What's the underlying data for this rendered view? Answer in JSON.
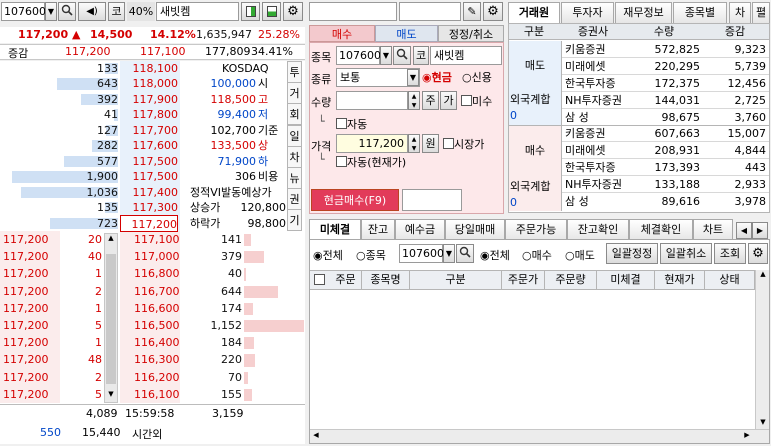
{
  "left": {
    "toolbar": {
      "code": "107600",
      "badge": "코",
      "margin": "40%",
      "name": "새빗켐"
    },
    "price_line": {
      "price": "117,200",
      "arrow": "▲",
      "change": "14,500",
      "rate": "14.12%",
      "volume": "1,635,947",
      "turnover": "25.28%"
    },
    "header": {
      "label": "증감",
      "bid_price": "117,200",
      "ask_price": "117,100",
      "volume": "177,809",
      "volume_rate": "34.41%"
    },
    "ask_rows": [
      {
        "qty": "133",
        "price": "118,100",
        "info_label": "KOSDAQ",
        "info_value": "",
        "bar": 0.12
      },
      {
        "qty": "643",
        "price": "118,000",
        "info_label": "시",
        "info_value": "100,000",
        "bar": 0.55
      },
      {
        "qty": "392",
        "price": "117,900",
        "info_label": "고",
        "info_value": "118,500",
        "bar": 0.34
      },
      {
        "qty": "41",
        "price": "117,800",
        "info_label": "저",
        "info_value": "99,400",
        "bar": 0.04
      },
      {
        "qty": "127",
        "price": "117,700",
        "info_label": "기준",
        "info_value": "102,700",
        "bar": 0.11
      },
      {
        "qty": "282",
        "price": "117,600",
        "info_label": "상",
        "info_value": "133,500",
        "bar": 0.24
      },
      {
        "qty": "577",
        "price": "117,500",
        "info_label": "하",
        "info_value": "71,900",
        "bar": 0.49
      },
      {
        "qty": "1,900",
        "price": "117,500",
        "info_label": "비용",
        "info_value": "306",
        "bar": 0.96
      },
      {
        "qty": "1,036",
        "price": "117,400",
        "info_label": "정적VI발동예상가",
        "info_value": "",
        "bar": 0.88
      },
      {
        "qty": "135",
        "price": "117,300",
        "info_label": "상승가",
        "info_value": "120,800",
        "bar": 0.12
      },
      {
        "qty": "723",
        "price": "117,200",
        "info_label": "하락가",
        "info_value": "98,800",
        "bar": 0.62
      }
    ],
    "side_buttons": [
      "투",
      "거",
      "회",
      "일",
      "차",
      "뉴",
      "권",
      "기"
    ],
    "bid_rows": [
      {
        "cmp": "117,200",
        "chg": "20",
        "price": "117,100",
        "qty": "141",
        "bar": 0.12
      },
      {
        "cmp": "117,200",
        "chg": "40",
        "price": "117,000",
        "qty": "379",
        "bar": 0.33
      },
      {
        "cmp": "117,200",
        "chg": "1",
        "price": "116,800",
        "qty": "40",
        "bar": 0.04
      },
      {
        "cmp": "117,200",
        "chg": "2",
        "price": "116,700",
        "qty": "644",
        "bar": 0.56
      },
      {
        "cmp": "117,200",
        "chg": "1",
        "price": "116,600",
        "qty": "174",
        "bar": 0.15
      },
      {
        "cmp": "117,200",
        "chg": "5",
        "price": "116,500",
        "qty": "1,152",
        "bar": 1.0
      },
      {
        "cmp": "117,200",
        "chg": "1",
        "price": "116,400",
        "qty": "184",
        "bar": 0.16
      },
      {
        "cmp": "117,200",
        "chg": "48",
        "price": "116,300",
        "qty": "220",
        "bar": 0.19
      },
      {
        "cmp": "117,200",
        "chg": "2",
        "price": "116,200",
        "qty": "70",
        "bar": 0.06
      },
      {
        "cmp": "117,200",
        "chg": "5",
        "price": "116,100",
        "qty": "155",
        "bar": 0.13
      }
    ],
    "footer": {
      "ask_total": "4,089",
      "time": "15:59:58",
      "bid_total": "3,159",
      "after_left": "550",
      "after_qty": "15,440",
      "after_label": "시간외"
    }
  },
  "order": {
    "tabs": [
      "매수",
      "매도",
      "정정/취소"
    ],
    "code_label": "종목",
    "code": "107600",
    "badge": "코",
    "name": "새빗켐",
    "type_label": "종류",
    "type_value": "보통",
    "radio_cash": "현금",
    "radio_credit": "신용",
    "qty_label": "수량",
    "qty_btn1": "주",
    "qty_btn2": "가",
    "undecided": "미수",
    "auto1": "자동",
    "price_label": "가격",
    "price_value": "117,200",
    "price_unit": "원",
    "market_price": "시장가",
    "auto2": "자동(현재가)",
    "submit": "현금매수(F9)"
  },
  "broker": {
    "tabs": [
      "거래원",
      "투자자",
      "재무정보",
      "종목별",
      "차",
      "펼"
    ],
    "headers": [
      "구분",
      "증권사",
      "수량",
      "증감"
    ],
    "sell_label": "매도",
    "buy_label": "매수",
    "foreign_label": "외국계합",
    "foreign_sell_val": "0",
    "foreign_buy_val": "0",
    "sell": [
      {
        "firm": "키움증권",
        "qty": "572,825",
        "chg": "9,323"
      },
      {
        "firm": "미래에셋",
        "qty": "220,295",
        "chg": "5,739"
      },
      {
        "firm": "한국투자증",
        "qty": "172,375",
        "chg": "12,456"
      },
      {
        "firm": "NH투자증권",
        "qty": "144,031",
        "chg": "2,725"
      },
      {
        "firm": "삼 성",
        "qty": "98,675",
        "chg": "3,760"
      }
    ],
    "buy": [
      {
        "firm": "키움증권",
        "qty": "607,663",
        "chg": "15,007"
      },
      {
        "firm": "미래에셋",
        "qty": "208,931",
        "chg": "4,844"
      },
      {
        "firm": "한국투자증",
        "qty": "173,393",
        "chg": "443"
      },
      {
        "firm": "NH투자증권",
        "qty": "133,188",
        "chg": "2,933"
      },
      {
        "firm": "삼 성",
        "qty": "89,616",
        "chg": "3,978"
      }
    ]
  },
  "bottom": {
    "tabs": [
      "미체결",
      "잔고",
      "예수금",
      "당일매매",
      "주문가능",
      "잔고확인",
      "체결확인",
      "차트"
    ],
    "filter1": {
      "all": "전체",
      "stock": "종목",
      "code": "107600"
    },
    "filter2": {
      "all": "전체",
      "buy": "매수",
      "sell": "매도"
    },
    "buttons": [
      "일괄정정",
      "일괄취소",
      "조회"
    ],
    "columns": [
      "주문",
      "종목명",
      "구분",
      "주문가",
      "주문량",
      "미체결",
      "현재가",
      "상태"
    ]
  },
  "colors": {
    "red": "#d40000",
    "blue": "#0046c8",
    "ask_bg": "#e8f1fb",
    "bid_bg": "#fbecec"
  }
}
